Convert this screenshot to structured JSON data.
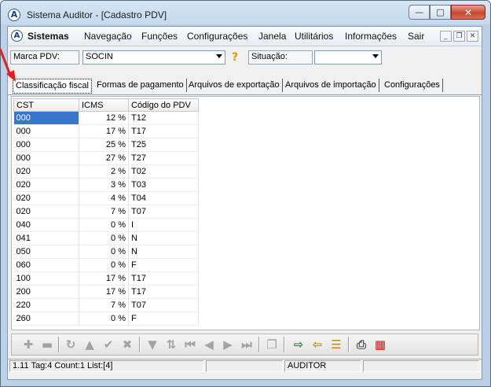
{
  "window": {
    "title": "Sistema Auditor - [Cadastro PDV]",
    "icon": "A"
  },
  "menu": [
    "Sistemas",
    "Navegação",
    "Funções",
    "Configurações",
    "Janela",
    "Utilitários",
    "Informações",
    "Sair"
  ],
  "filter": {
    "marca_label": "Marca PDV:",
    "marca_value": "SOCIN",
    "situacao_label": "Situação:",
    "situacao_value": ""
  },
  "tabs": [
    "Classificação fiscal",
    "Formas de pagamento",
    "Arquivos de exportação",
    "Arquivos de importação",
    "Configurações"
  ],
  "grid": {
    "columns": [
      "CST",
      "ICMS",
      "Código do PDV"
    ],
    "rows": [
      [
        "000",
        "12 %",
        "T12"
      ],
      [
        "000",
        "17 %",
        "T17"
      ],
      [
        "000",
        "25 %",
        "T25"
      ],
      [
        "000",
        "27 %",
        "T27"
      ],
      [
        "020",
        "2 %",
        "T02"
      ],
      [
        "020",
        "3 %",
        "T03"
      ],
      [
        "020",
        "4 %",
        "T04"
      ],
      [
        "020",
        "7 %",
        "T07"
      ],
      [
        "040",
        "0 %",
        "I"
      ],
      [
        "041",
        "0 %",
        "N"
      ],
      [
        "050",
        "0 %",
        "N"
      ],
      [
        "060",
        "0 %",
        "F"
      ],
      [
        "100",
        "17 %",
        "T17"
      ],
      [
        "200",
        "17 %",
        "T17"
      ],
      [
        "220",
        "7 %",
        "T07"
      ],
      [
        "260",
        "0 %",
        "F"
      ]
    ]
  },
  "toolbar": [
    "plus-icon",
    "minus-icon",
    "refresh-icon",
    "up-icon",
    "check-icon",
    "cancel-icon",
    "filter-icon",
    "sort-icon",
    "first-icon",
    "prev-icon",
    "next-icon",
    "last-icon",
    "copy-icon",
    "export-icon",
    "import-icon",
    "query-icon",
    "print-icon",
    "report-icon"
  ],
  "status": {
    "info": "1.11 Tag:4 Count:1 List:[4]",
    "user": "AUDITOR"
  },
  "colors": {
    "selection": "#3a76c8",
    "annotation_arrow": "#e02020"
  }
}
